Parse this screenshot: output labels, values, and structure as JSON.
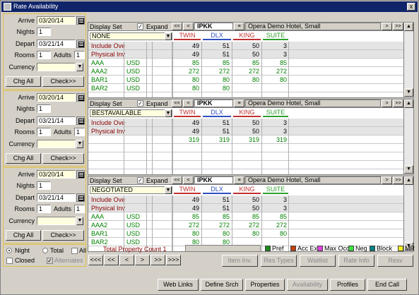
{
  "window": {
    "title": "Rate Availability",
    "close_label": "x"
  },
  "panels": [
    {
      "search": {
        "arrive_label": "Arrive",
        "arrive": "03/20/14",
        "nights_label": "Nights",
        "nights": "1",
        "depart_label": "Depart",
        "depart": "03/21/14",
        "rooms_label": "Rooms",
        "rooms": "1",
        "adults_label": "Adults",
        "adults": "1",
        "currency_label": "Currency",
        "currency": "",
        "chg_all": "Chg All",
        "check": "Check>>"
      },
      "grid": {
        "display_set_label": "Display Set",
        "expand_label": "Expand",
        "hotel_code": "IPKK",
        "hotel_name": "Opera Demo Hotel, Small",
        "rate_set": "NONE",
        "room_types": [
          "TWIN",
          "DLX",
          "KING",
          "SUITE"
        ],
        "rows": [
          {
            "label": "Include Overbooking",
            "cur": "",
            "vals": [
              "49",
              "51",
              "50",
              "3"
            ],
            "style": "red",
            "shaded": true
          },
          {
            "label": "Physical Inventory",
            "cur": "",
            "vals": [
              "49",
              "51",
              "50",
              "3"
            ],
            "style": "red",
            "shaded": true
          },
          {
            "label": "AAA",
            "cur": "USD",
            "vals": [
              "85",
              "85",
              "85",
              "85"
            ],
            "style": "green",
            "shaded": false
          },
          {
            "label": "AAA2",
            "cur": "USD",
            "vals": [
              "272",
              "272",
              "272",
              "272"
            ],
            "style": "green",
            "shaded": false
          },
          {
            "label": "BAR1",
            "cur": "USD",
            "vals": [
              "80",
              "80",
              "80",
              "80"
            ],
            "style": "green",
            "shaded": false
          },
          {
            "label": "BAR2",
            "cur": "USD",
            "vals": [
              "80",
              "80",
              "",
              ""
            ],
            "style": "green",
            "shaded": false
          }
        ]
      }
    },
    {
      "search": {
        "arrive_label": "Arrive",
        "arrive": "03/20/14",
        "nights_label": "Nights",
        "nights": "1",
        "depart_label": "Depart",
        "depart": "03/21/14",
        "rooms_label": "Rooms",
        "rooms": "1",
        "adults_label": "Adults",
        "adults": "1",
        "currency_label": "Currency",
        "currency": "",
        "chg_all": "Chg All",
        "check": "Check>>"
      },
      "grid": {
        "display_set_label": "Display Set",
        "expand_label": "Expand",
        "hotel_code": "IPKK",
        "hotel_name": "Opera Demo Hotel, Small",
        "rate_set": "BESTAVAILABLE",
        "room_types": [
          "TWIN",
          "DLX",
          "KING",
          "SUITE"
        ],
        "rows": [
          {
            "label": "Include Overbooking",
            "cur": "",
            "vals": [
              "49",
              "51",
              "50",
              "3"
            ],
            "style": "red",
            "shaded": true
          },
          {
            "label": "Physical Inventory",
            "cur": "",
            "vals": [
              "49",
              "51",
              "50",
              "3"
            ],
            "style": "red",
            "shaded": true
          },
          {
            "label": "",
            "cur": "",
            "vals": [
              "319",
              "319",
              "319",
              "319"
            ],
            "style": "green",
            "shaded": false
          },
          {
            "label": "",
            "cur": "",
            "vals": [
              "",
              "",
              "",
              ""
            ],
            "style": "green",
            "shaded": false
          },
          {
            "label": "",
            "cur": "",
            "vals": [
              "",
              "",
              "",
              ""
            ],
            "style": "green",
            "shaded": false
          },
          {
            "label": "",
            "cur": "",
            "vals": [
              "",
              "",
              "",
              ""
            ],
            "style": "green",
            "shaded": false
          }
        ]
      }
    },
    {
      "search": {
        "arrive_label": "Arrive",
        "arrive": "03/20/14",
        "nights_label": "Nights",
        "nights": "1",
        "depart_label": "Depart",
        "depart": "03/21/14",
        "rooms_label": "Rooms",
        "rooms": "1",
        "adults_label": "Adults",
        "adults": "1",
        "currency_label": "Currency",
        "currency": "",
        "chg_all": "Chg All",
        "check": "Check>>"
      },
      "grid": {
        "display_set_label": "Display Set",
        "expand_label": "Expand",
        "hotel_code": "IPKK",
        "hotel_name": "Opera Demo Hotel, Small",
        "rate_set": "NEGOTIATED",
        "room_types": [
          "TWIN",
          "DLX",
          "KING",
          "SUITE"
        ],
        "rows": [
          {
            "label": "Include Overbooking",
            "cur": "",
            "vals": [
              "49",
              "51",
              "50",
              "3"
            ],
            "style": "red",
            "shaded": true
          },
          {
            "label": "Physical Inventory",
            "cur": "",
            "vals": [
              "49",
              "51",
              "50",
              "3"
            ],
            "style": "red",
            "shaded": true
          },
          {
            "label": "AAA",
            "cur": "USD",
            "vals": [
              "85",
              "85",
              "85",
              "85"
            ],
            "style": "green",
            "shaded": false
          },
          {
            "label": "AAA2",
            "cur": "USD",
            "vals": [
              "272",
              "272",
              "272",
              "272"
            ],
            "style": "green",
            "shaded": false
          },
          {
            "label": "BAR1",
            "cur": "USD",
            "vals": [
              "80",
              "80",
              "80",
              "80"
            ],
            "style": "green",
            "shaded": false
          },
          {
            "label": "BAR2",
            "cur": "USD",
            "vals": [
              "80",
              "80",
              "",
              ""
            ],
            "style": "green",
            "shaded": false
          }
        ]
      }
    }
  ],
  "options": {
    "night": "Night",
    "total": "Total",
    "all": "All",
    "closed": "Closed",
    "alternates": "Alternates"
  },
  "footer": {
    "total_count": "Total Property Count 1",
    "nav": [
      "<<<",
      "<<",
      "<",
      ">",
      ">>",
      ">>>"
    ],
    "legend": [
      {
        "label": "Pref",
        "color": "#1a8a1a"
      },
      {
        "label": "Acc Ex",
        "color": "#c04010"
      },
      {
        "label": "Max Occ",
        "color": "#e040e0"
      },
      {
        "label": "Neg",
        "color": "#40e040"
      },
      {
        "label": "Block",
        "color": "#008080"
      },
      {
        "label": "MR",
        "color": "#f0f020"
      }
    ],
    "actions": [
      "Item Inv.",
      "Res Types",
      "Waitlist",
      "Rate Info",
      "Resv"
    ],
    "bottom_buttons": [
      "Web Links",
      "Define Srch",
      "Properties",
      "Availability",
      "Profiles",
      "End Call"
    ]
  },
  "room_type_colors": [
    "#c03030",
    "#3050c0",
    "#c03030",
    "#30a030"
  ]
}
